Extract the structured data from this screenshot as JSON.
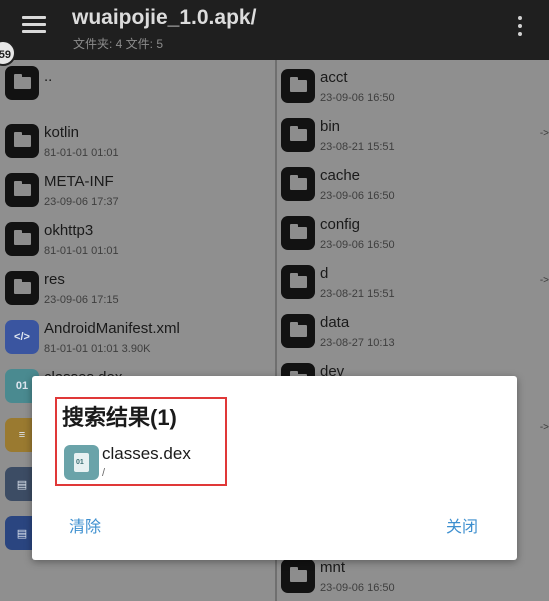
{
  "topbar": {
    "title": "wuaipojie_1.0.apk/",
    "subtitle": "文件夹: 4  文件: 5",
    "badge": "59"
  },
  "left_pane": {
    "items": [
      {
        "name": "..",
        "meta": "",
        "kind": "folder"
      },
      {
        "name": "kotlin",
        "meta": "81-01-01 01:01",
        "kind": "folder"
      },
      {
        "name": "META-INF",
        "meta": "23-09-06 17:37",
        "kind": "folder"
      },
      {
        "name": "okhttp3",
        "meta": "81-01-01 01:01",
        "kind": "folder"
      },
      {
        "name": "res",
        "meta": "23-09-06 17:15",
        "kind": "folder"
      },
      {
        "name": "AndroidManifest.xml",
        "meta": "81-01-01 01:01  3.90K",
        "kind": "xml"
      },
      {
        "name": "classes.dex",
        "meta": "",
        "kind": "dex"
      }
    ]
  },
  "right_pane": {
    "items": [
      {
        "name": "acct",
        "meta": "23-09-06 16:50",
        "arrow": ""
      },
      {
        "name": "bin",
        "meta": "23-08-21 15:51",
        "arrow": "->"
      },
      {
        "name": "cache",
        "meta": "23-09-06 16:50",
        "arrow": ""
      },
      {
        "name": "config",
        "meta": "23-09-06 16:50",
        "arrow": ""
      },
      {
        "name": "d",
        "meta": "23-08-21 15:51",
        "arrow": "->"
      },
      {
        "name": "data",
        "meta": "23-08-27 10:13",
        "arrow": ""
      },
      {
        "name": "dev",
        "meta": "",
        "arrow": ""
      }
    ],
    "bottom_item": {
      "name": "mnt",
      "meta": "23-09-06 16:50"
    },
    "arrow_between": "->"
  },
  "dialog": {
    "title": "搜索结果(1)",
    "result": {
      "name": "classes.dex",
      "path": "/",
      "icon_label": "01"
    },
    "clear_label": "清除",
    "close_label": "关闭"
  }
}
